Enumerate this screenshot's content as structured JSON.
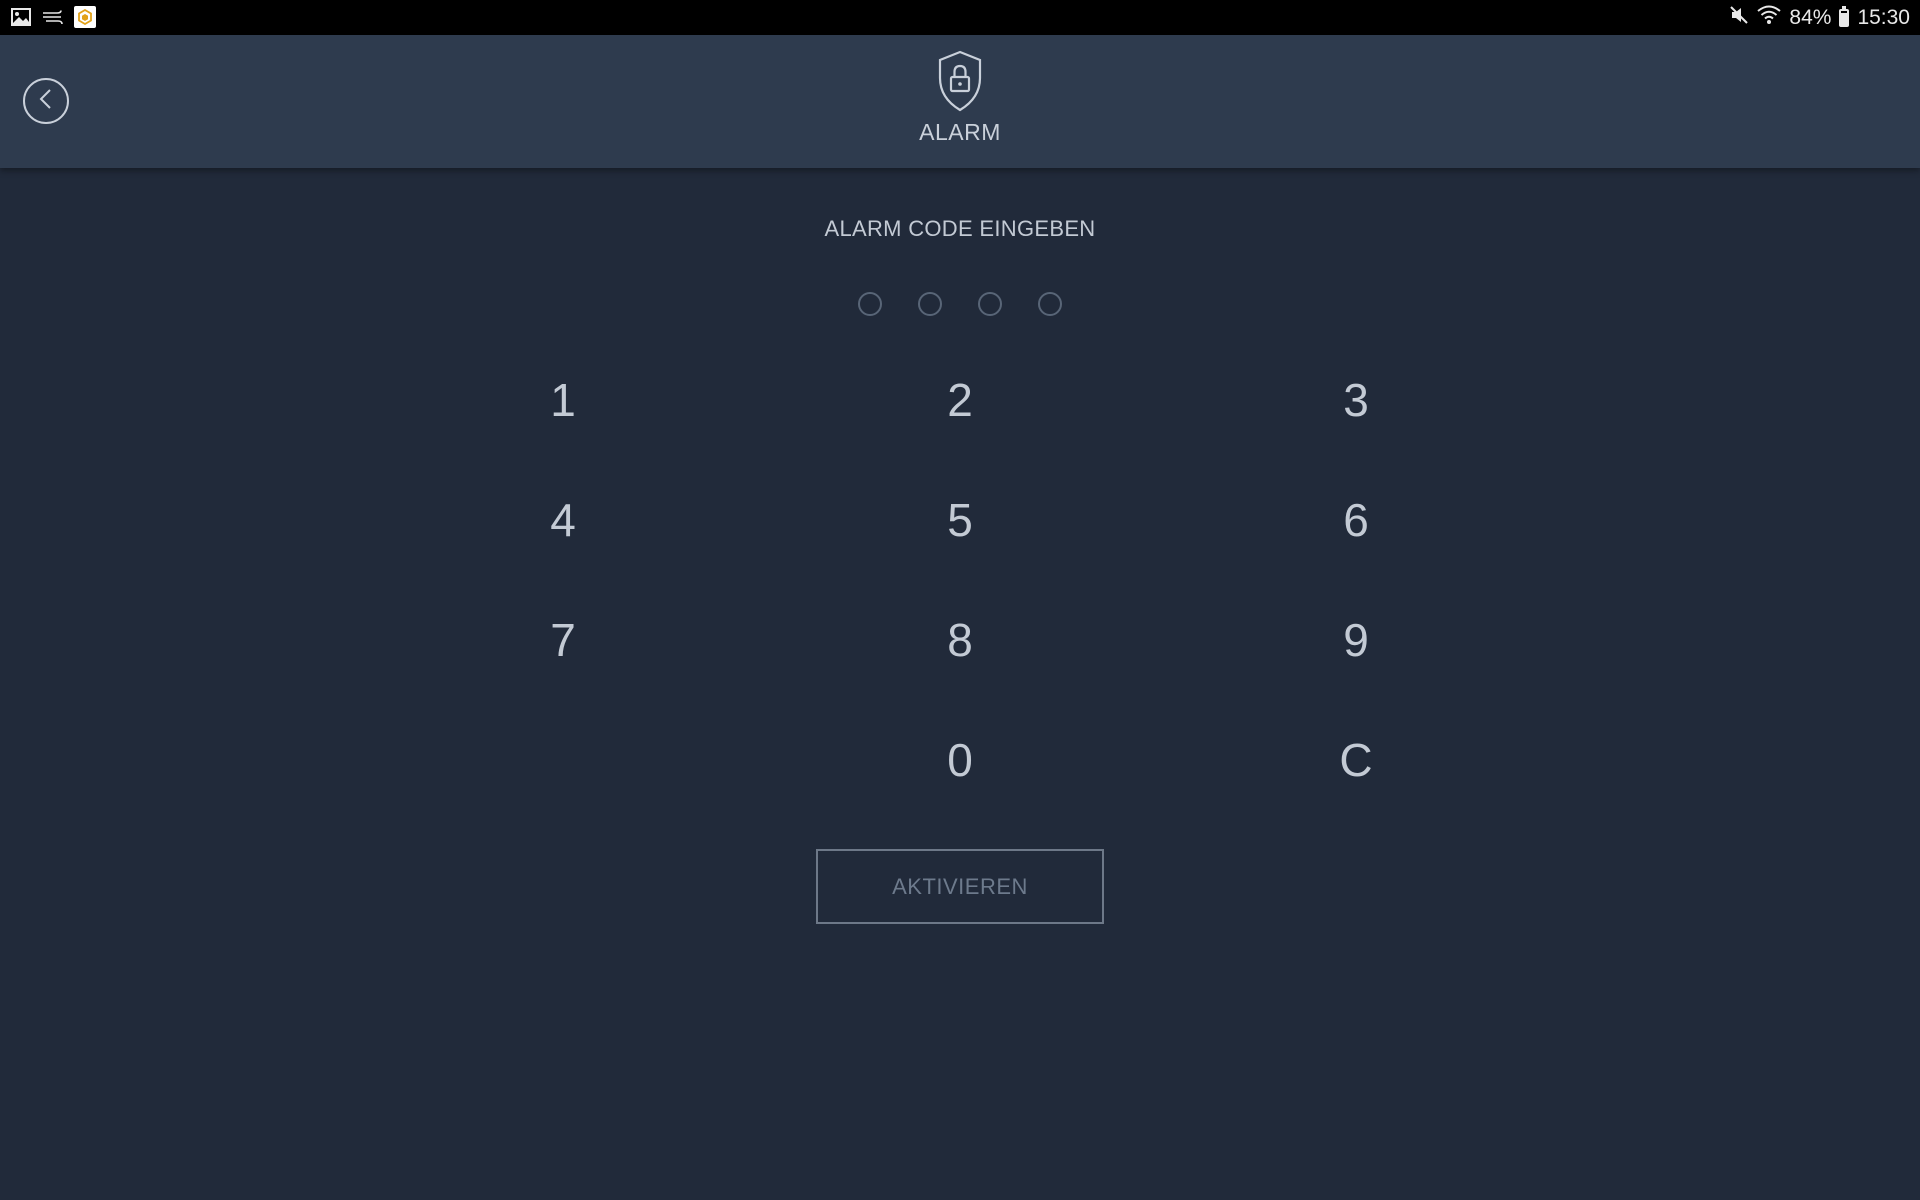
{
  "status_bar": {
    "icons_left": [
      "gallery-icon",
      "wind-icon",
      "app-icon"
    ],
    "battery_percent": "84%",
    "time": "15:30",
    "icons_right": [
      "mute-icon",
      "wifi-icon",
      "battery-icon"
    ]
  },
  "header": {
    "title": "ALARM",
    "icon": "shield-lock-icon",
    "back_icon": "chevron-left-icon"
  },
  "main": {
    "prompt": "ALARM CODE EINGEBEN",
    "code_length": 4,
    "code_entered": 0,
    "keys": [
      "1",
      "2",
      "3",
      "4",
      "5",
      "6",
      "7",
      "8",
      "9",
      "0",
      "C"
    ],
    "activate_label": "AKTIVIEREN"
  },
  "colors": {
    "background": "#212a3a",
    "header": "#2e3b4e",
    "text": "#c3cad4",
    "muted": "#6d7a8c"
  }
}
